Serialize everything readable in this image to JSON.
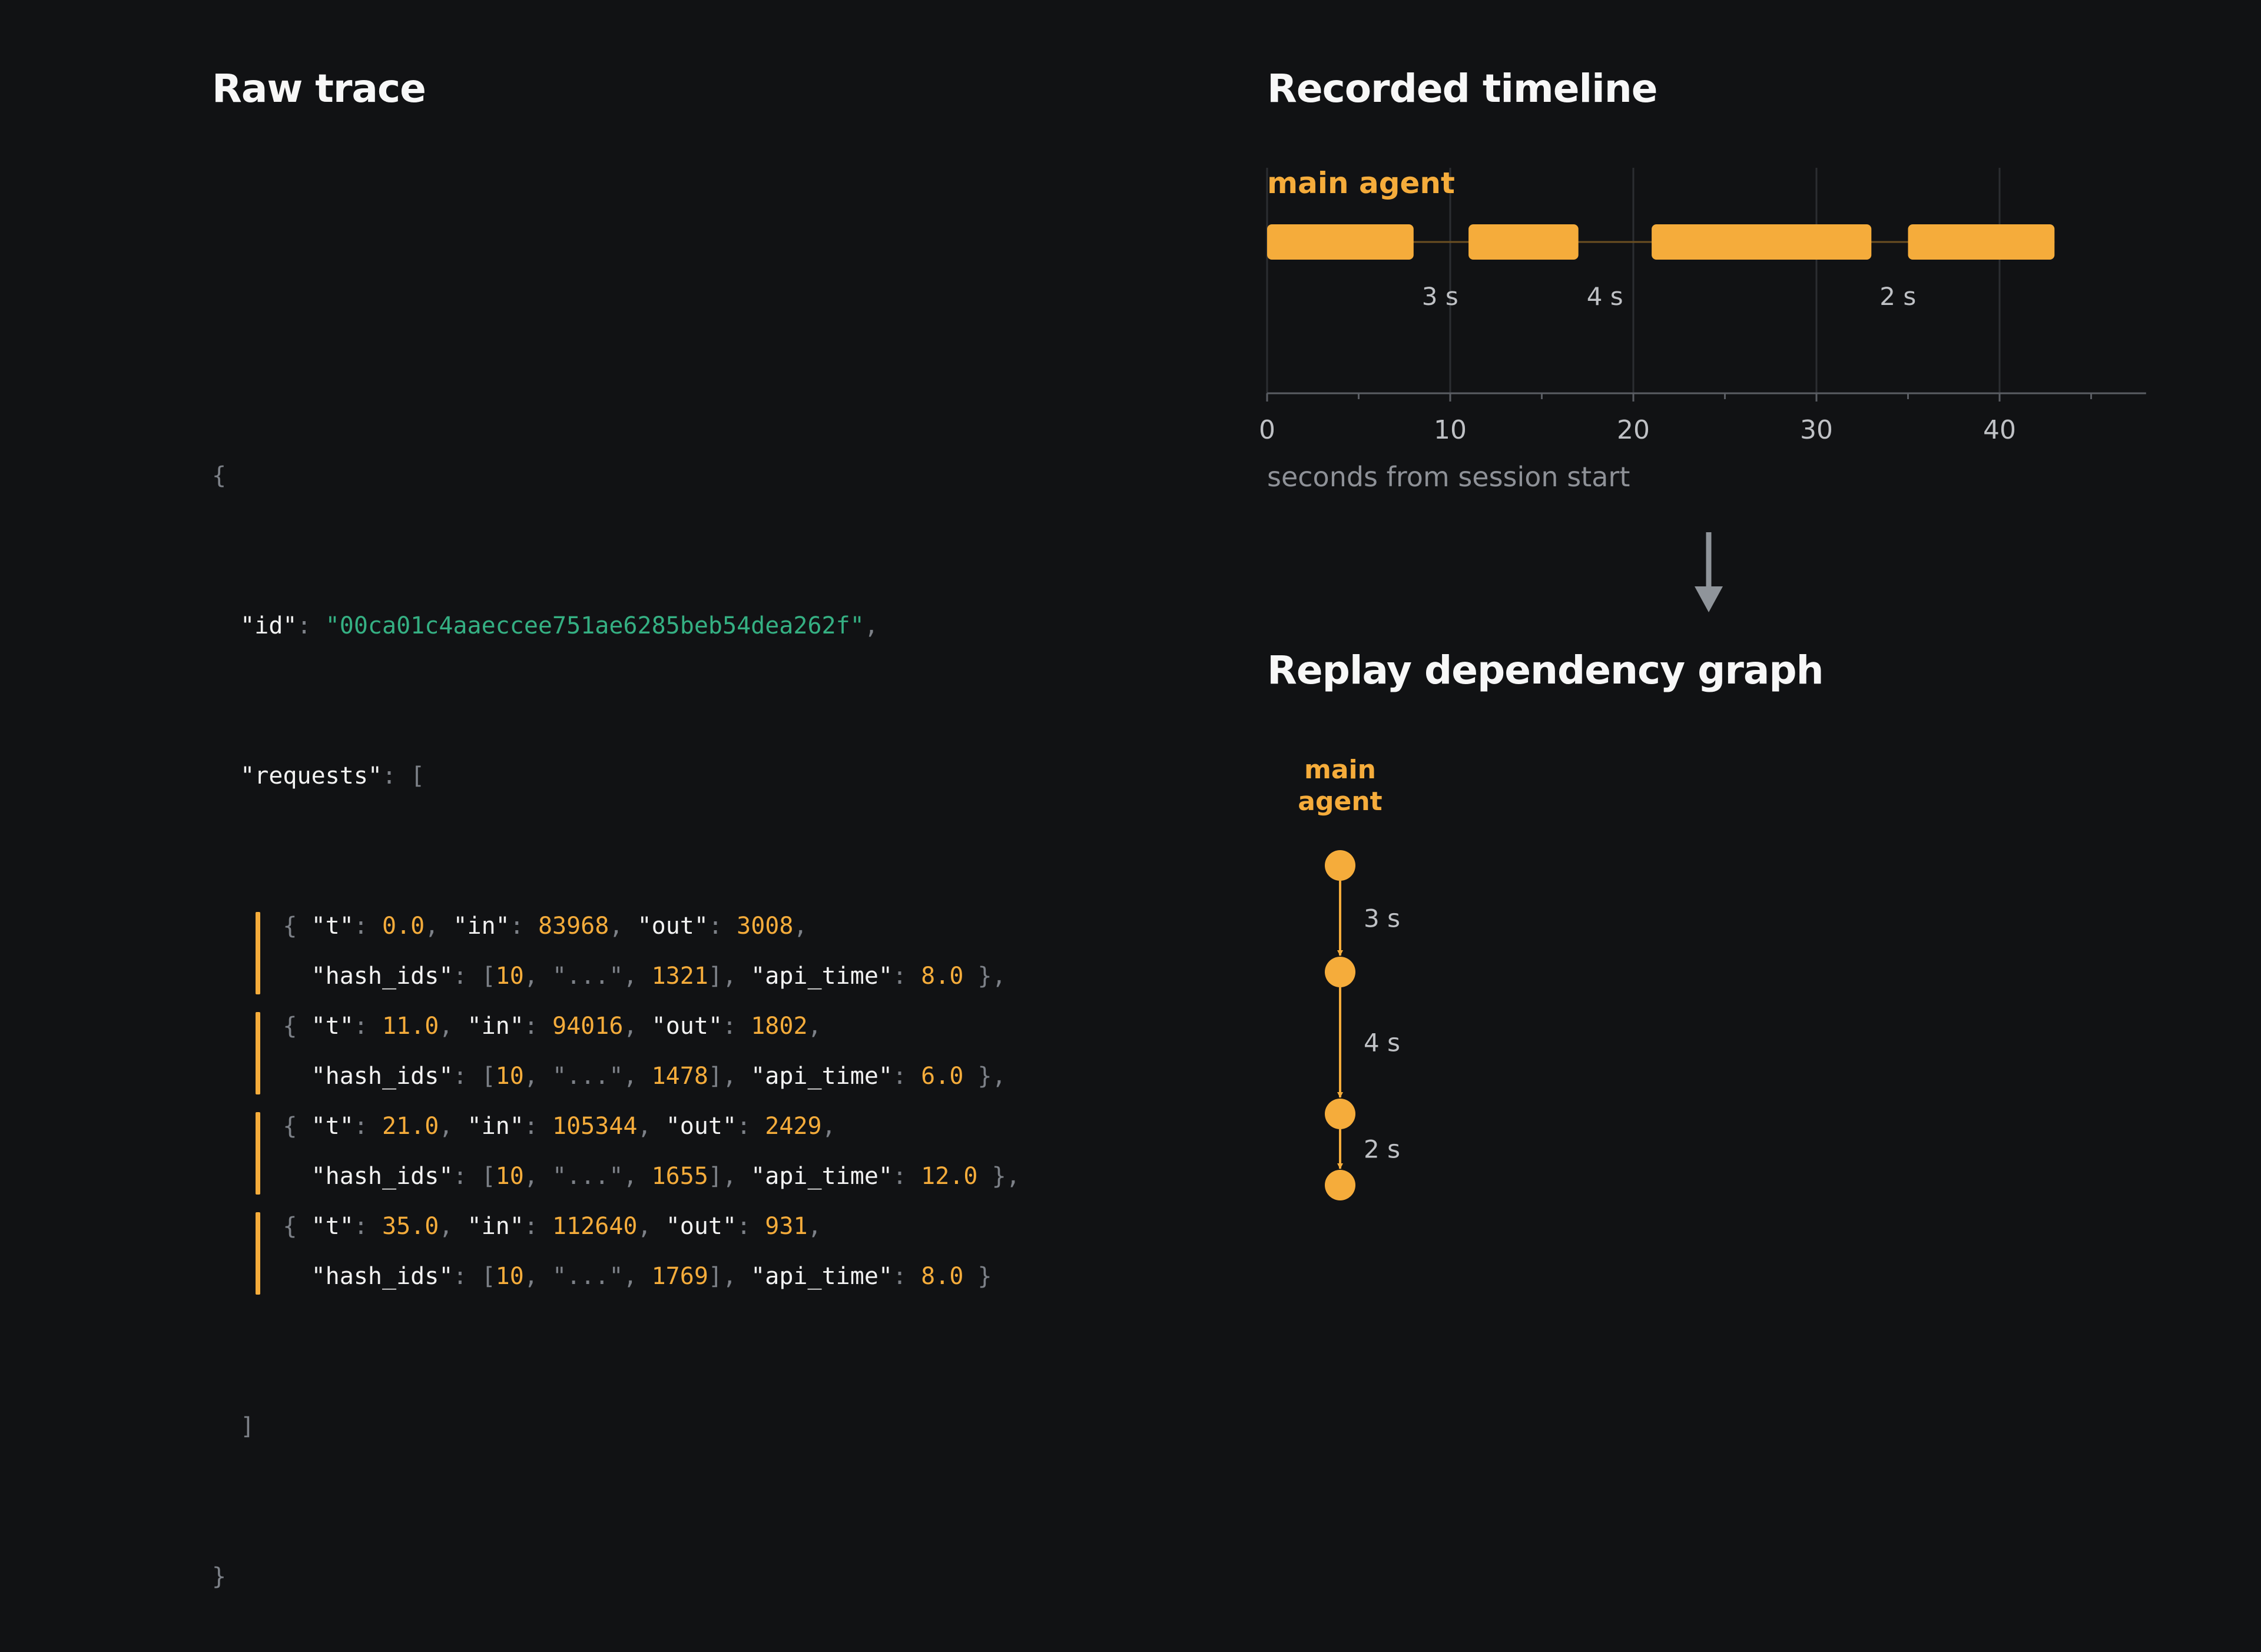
{
  "headings": {
    "raw_trace": "Raw trace",
    "recorded_timeline": "Recorded timeline",
    "replay_graph": "Replay dependency graph"
  },
  "trace": {
    "id": "00ca01c4aaeccee751ae6285beb54dea262f",
    "requests": [
      {
        "t": "0.0",
        "in": "83968",
        "out": "3008",
        "hash_first": "10",
        "hash_mid": "\"...\"",
        "hash_last": "1321",
        "api_time": "8.0"
      },
      {
        "t": "11.0",
        "in": "94016",
        "out": "1802",
        "hash_first": "10",
        "hash_mid": "\"...\"",
        "hash_last": "1478",
        "api_time": "6.0"
      },
      {
        "t": "21.0",
        "in": "105344",
        "out": "2429",
        "hash_first": "10",
        "hash_mid": "\"...\"",
        "hash_last": "1655",
        "api_time": "12.0"
      },
      {
        "t": "35.0",
        "in": "112640",
        "out": "931",
        "hash_first": "10",
        "hash_mid": "\"...\"",
        "hash_last": "1769",
        "api_time": "8.0"
      }
    ]
  },
  "timeline": {
    "lane_label": "main agent",
    "xlabel": "seconds from session start",
    "xlim": [
      0,
      48
    ],
    "major_ticks": [
      0,
      10,
      20,
      30,
      40
    ],
    "minor_ticks": [
      5,
      15,
      25,
      35,
      45
    ],
    "bars": [
      {
        "start": 0.0,
        "end": 8.0
      },
      {
        "start": 11.0,
        "end": 17.0
      },
      {
        "start": 21.0,
        "end": 33.0
      },
      {
        "start": 35.0,
        "end": 43.0
      }
    ],
    "gaps": [
      {
        "at": 8.0,
        "label": "3 s"
      },
      {
        "at": 17.0,
        "label": "4 s"
      },
      {
        "at": 33.0,
        "label": "2 s"
      }
    ]
  },
  "graph": {
    "node_label_line1": "main",
    "node_label_line2": "agent",
    "edge_labels": [
      "3 s",
      "4 s",
      "2 s"
    ]
  },
  "colors": {
    "background": "#111214",
    "accent": "#f5ac3b",
    "string": "#35b083",
    "punctuation": "#7d8188",
    "muted_text": "#8e9197",
    "grid": "#2b2d31",
    "arrow": "#8f949a"
  }
}
